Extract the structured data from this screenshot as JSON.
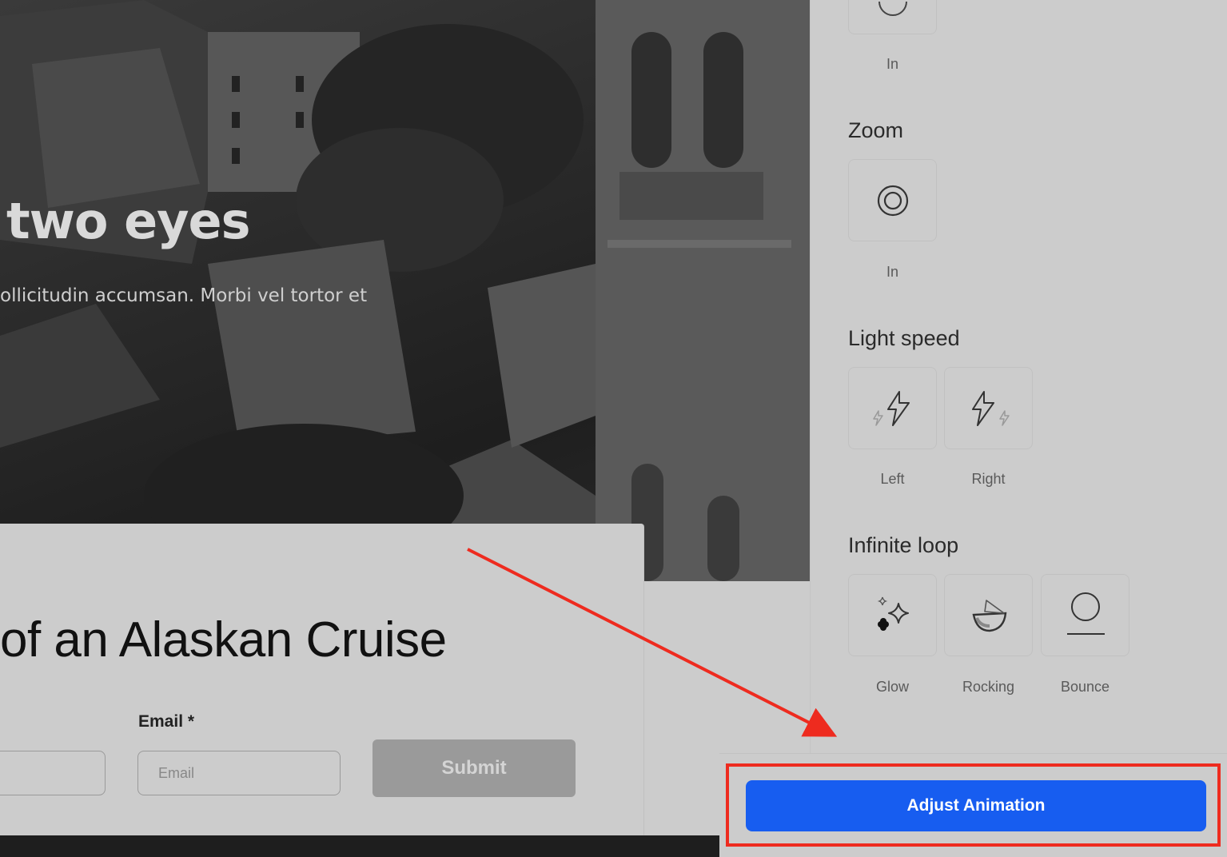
{
  "hero": {
    "title": "two eyes",
    "subtitle": "ollicitudin accumsan. Morbi vel tortor et"
  },
  "form": {
    "title": "of an Alaskan Cruise",
    "email_label": "Email *",
    "email_placeholder": "Email",
    "submit_label": "Submit"
  },
  "panel": {
    "sections": [
      {
        "title": "",
        "items": [
          {
            "label": "In",
            "icon": "circle-icon"
          }
        ]
      },
      {
        "title": "Zoom",
        "items": [
          {
            "label": "In",
            "icon": "zoom-in-icon"
          }
        ]
      },
      {
        "title": "Light speed",
        "items": [
          {
            "label": "Left",
            "icon": "lightning-left-icon"
          },
          {
            "label": "Right",
            "icon": "lightning-right-icon"
          }
        ]
      },
      {
        "title": "Infinite loop",
        "items": [
          {
            "label": "Glow",
            "icon": "sparkle-icon"
          },
          {
            "label": "Rocking",
            "icon": "rocking-icon"
          },
          {
            "label": "Bounce",
            "icon": "bounce-icon"
          }
        ]
      }
    ],
    "adjust_button": "Adjust Animation"
  },
  "colors": {
    "accent": "#175df0",
    "highlight": "#ee2b1f",
    "overlay": "#cccccc"
  }
}
